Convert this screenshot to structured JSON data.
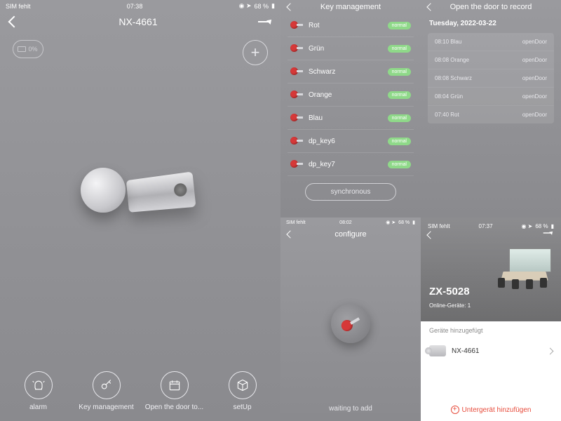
{
  "status": {
    "carrier": "SIM fehlt",
    "time_main": "07:38",
    "time_b": "08:02",
    "time_c": "07:37",
    "battery": "68 %",
    "icons": "◉ ➤"
  },
  "main": {
    "title": "NX-4661",
    "battery_pct": "0%",
    "nav": [
      {
        "label": "alarm"
      },
      {
        "label": "Key management"
      },
      {
        "label": "Open the door to..."
      },
      {
        "label": "setUp"
      }
    ]
  },
  "keys": {
    "title": "Key management",
    "badge": "normal",
    "items": [
      "Rot",
      "Grün",
      "Schwarz",
      "Orange",
      "Blau",
      "dp_key6",
      "dp_key7"
    ],
    "sync": "synchronous"
  },
  "records": {
    "title": "Open the door to record",
    "date": "Tuesday, 2022-03-22",
    "action": "openDoor",
    "rows": [
      {
        "t": "08:10",
        "n": "Blau"
      },
      {
        "t": "08:08",
        "n": "Orange"
      },
      {
        "t": "08:08",
        "n": "Schwarz"
      },
      {
        "t": "08:04",
        "n": "Grün"
      },
      {
        "t": "07:40",
        "n": "Rot"
      }
    ]
  },
  "configure": {
    "title": "configure",
    "waiting": "waiting to add"
  },
  "home": {
    "room": "ZX-5028",
    "online": "Online-Geräte: 1",
    "section": "Geräte hinzugefügt",
    "device": "NX-4661",
    "add": "Untergerät hinzufügen"
  }
}
